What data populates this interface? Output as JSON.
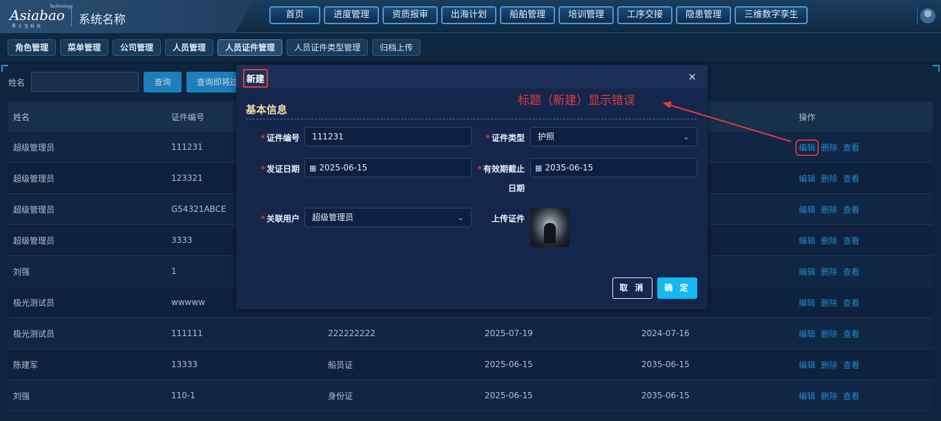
{
  "header": {
    "logo": "Asiabao",
    "logo_tech": "Technology",
    "logo_sub": "黑土宝科技",
    "system_name": "系统名称",
    "nav": [
      "首页",
      "进度管理",
      "资质报审",
      "出海计划",
      "船舶管理",
      "培训管理",
      "工序交接",
      "隐患管理",
      "三维数字孪生"
    ]
  },
  "tabs": [
    {
      "label": "角色管理",
      "active": false
    },
    {
      "label": "菜单管理",
      "active": false
    },
    {
      "label": "公司管理",
      "active": false
    },
    {
      "label": "人员管理",
      "active": false
    },
    {
      "label": "人员证件管理",
      "active": true
    },
    {
      "label": "人员证件类型管理",
      "active": false
    },
    {
      "label": "归档上传",
      "active": false
    }
  ],
  "search": {
    "label": "姓名",
    "query_button": "查询",
    "query2_button": "查询即将过"
  },
  "table": {
    "headers": [
      "姓名",
      "证件编号",
      "",
      "",
      "",
      "操作"
    ],
    "rows": [
      {
        "name": "超级管理员",
        "cert_no": "111231",
        "type": "",
        "issue": "",
        "expire": ""
      },
      {
        "name": "超级管理员",
        "cert_no": "123321",
        "type": "",
        "issue": "",
        "expire": ""
      },
      {
        "name": "超级管理员",
        "cert_no": "G54321ABCE",
        "type": "",
        "issue": "",
        "expire": ""
      },
      {
        "name": "超级管理员",
        "cert_no": "3333",
        "type": "",
        "issue": "",
        "expire": ""
      },
      {
        "name": "刘强",
        "cert_no": "1",
        "type": "",
        "issue": "",
        "expire": ""
      },
      {
        "name": "极光测试员",
        "cert_no": "wwwww",
        "type": "",
        "issue": "",
        "expire": ""
      },
      {
        "name": "极光测试员",
        "cert_no": "111111",
        "type": "222222222",
        "issue": "2025-07-19",
        "expire": "2024-07-16"
      },
      {
        "name": "陈建军",
        "cert_no": "13333",
        "type": "船员证",
        "issue": "2025-06-15",
        "expire": "2035-06-15"
      },
      {
        "name": "刘强",
        "cert_no": "110-1",
        "type": "身份证",
        "issue": "2025-06-15",
        "expire": "2035-06-15"
      }
    ],
    "actions": {
      "edit": "编辑",
      "delete": "删除",
      "view": "查看"
    }
  },
  "modal": {
    "title": "新建",
    "close": "×",
    "section": "基本信息",
    "fields": {
      "cert_no_label": "证件编号",
      "cert_no_value": "111231",
      "cert_type_label": "证件类型",
      "cert_type_value": "护照",
      "issue_label": "发证日期",
      "issue_value": "2025-06-15",
      "expire_label_1": "有效期截止",
      "expire_label_2": "日期",
      "expire_value": "2035-06-15",
      "user_label": "关联用户",
      "user_value": "超级管理员",
      "upload_label": "上传证件"
    },
    "cancel": "取 消",
    "ok": "确 定"
  },
  "annotation": {
    "text": "标题（新建）显示错误",
    "color": "#e23b3b"
  }
}
